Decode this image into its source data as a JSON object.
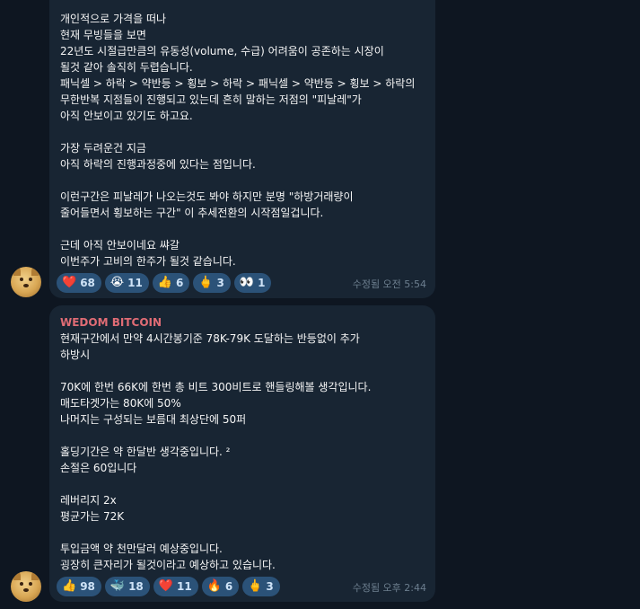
{
  "messages": [
    {
      "sender": "",
      "lines": [
        "개인적으로 가격을 떠나",
        "현재 무빙들을 보면",
        "22년도 시절급만큼의 유동성(volume, 수급) 어려움이 공존하는 시장이",
        "될것 같아 솔직히 두렵습니다.",
        "패닉셀 > 하락 > 약반등 > 횡보 > 하락 > 패닉셀 > 약반등 > 횡보 > 하락의",
        "무한반복 지점들이 진행되고 있는데 흔히 말하는 저점의 \"피날레\"가",
        "아직 안보이고 있기도 하고요.",
        "",
        "가장 두려운건 지금",
        "아직 하락의 진행과정중에 있다는 점입니다.",
        "",
        "이런구간은 피날레가 나오는것도 봐야 하지만 분명 \"하방거래량이",
        "줄어들면서 횡보하는 구간\" 이 추세전환의 시작점일겁니다.",
        "",
        "근데 아직 안보이네요 쌰갈",
        "이번주가 고비의 한주가 될것 같습니다."
      ],
      "reactions": [
        {
          "emoji": "❤️",
          "icon": "heart-icon",
          "count": "68"
        },
        {
          "emoji": "😭",
          "icon": "crying-face-icon",
          "count": "11"
        },
        {
          "emoji": "👍",
          "icon": "thumbs-up-icon",
          "count": "6"
        },
        {
          "emoji": "🖕",
          "icon": "middle-finger-icon",
          "count": "3"
        },
        {
          "emoji": "👀",
          "icon": "eyes-icon",
          "count": "1"
        }
      ],
      "meta": "수정됨 오전 5:54"
    },
    {
      "sender": "WEDOM BITCOIN",
      "lines": [
        "현재구간에서 만약 4시간봉기준 78K-79K 도달하는 반등없이 추가",
        "하방시",
        "",
        "70K에 한번 66K에 한번 총 비트 300비트로 핸들링해볼 생각입니다.",
        "매도타겟가는 80K에 50%",
        "나머지는 구성되는 보름대 최상단에 50퍼",
        "",
        "홀딩기간은 약 한달반 생각중입니다. ²",
        "손절은 60입니다",
        "",
        "레버리지 2x",
        "평균가는 72K",
        "",
        "투입금액 약 천만달러 예상중입니다.",
        "굉장히 큰자리가 될것이라고 예상하고 있습니다."
      ],
      "reactions": [
        {
          "emoji": "👍",
          "icon": "thumbs-up-icon",
          "count": "98"
        },
        {
          "emoji": "🐳",
          "icon": "whale-icon",
          "count": "18"
        },
        {
          "emoji": "❤️",
          "icon": "heart-icon",
          "count": "11"
        },
        {
          "emoji": "🔥",
          "icon": "fire-icon",
          "count": "6"
        },
        {
          "emoji": "🖕",
          "icon": "middle-finger-icon",
          "count": "3"
        }
      ],
      "meta": "수정됨 오후 2:44"
    }
  ],
  "colors": {
    "background": "#0e1621",
    "bubble": "#182533",
    "sender": "#e06c75",
    "reaction_bg": "#2b5278",
    "meta": "#6d7f8f"
  }
}
